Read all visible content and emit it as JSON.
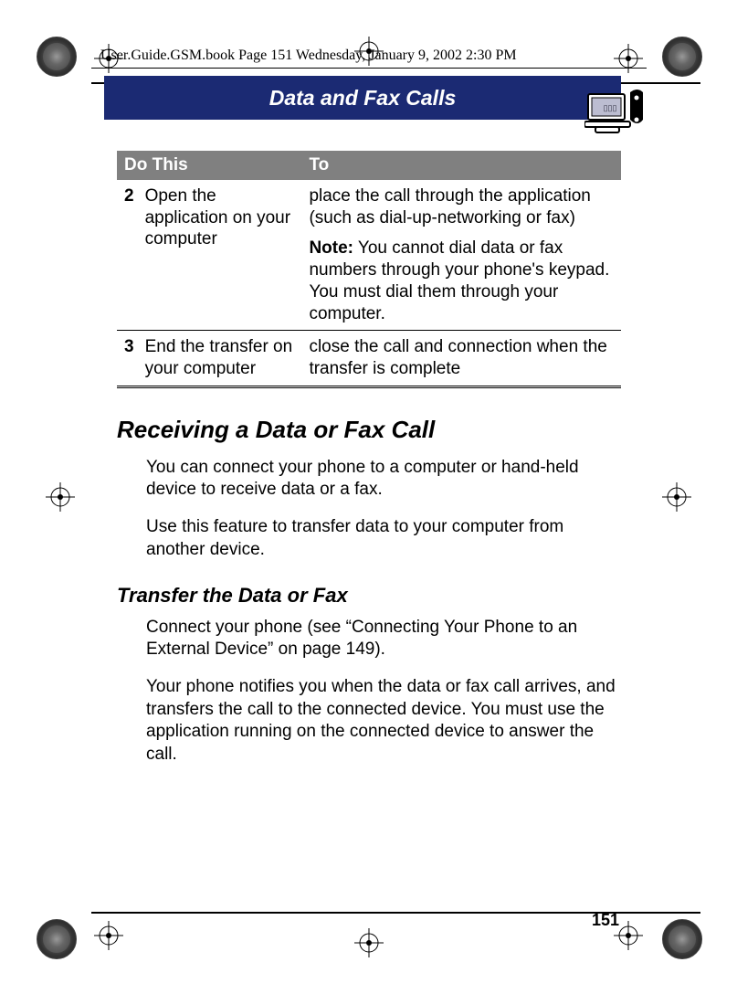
{
  "header_line": "User.Guide.GSM.book  Page 151  Wednesday, January 9, 2002  2:30 PM",
  "section_banner": "Data and Fax Calls",
  "banner_icon_name": "computer-phone-icon",
  "table": {
    "headers": [
      "Do This",
      "To"
    ],
    "rows": [
      {
        "num": "2",
        "do": "Open the application on your computer",
        "to_main": "place the call through the application (such as dial-up-networking or fax)",
        "note_label": "Note:",
        "note_text": " You cannot dial data or fax numbers through your phone's keypad. You must dial them through your computer."
      },
      {
        "num": "3",
        "do": "End the transfer on your computer",
        "to_main": "close the call and connection when the transfer is complete"
      }
    ]
  },
  "heading_receiving": "Receiving a Data or Fax Call",
  "para1": "You can connect your phone to a computer or hand-held device to receive data or a fax.",
  "para2": "Use this feature to transfer data to your computer from another device.",
  "subheading_transfer": "Transfer the Data or Fax",
  "para3": "Connect your phone (see “Connecting Your Phone to an External Device” on page 149).",
  "para4": "Your phone notifies you when the data or fax call arrives, and transfers the call to the connected device. You must use the application running on the connected device to answer the call.",
  "page_number": "151"
}
